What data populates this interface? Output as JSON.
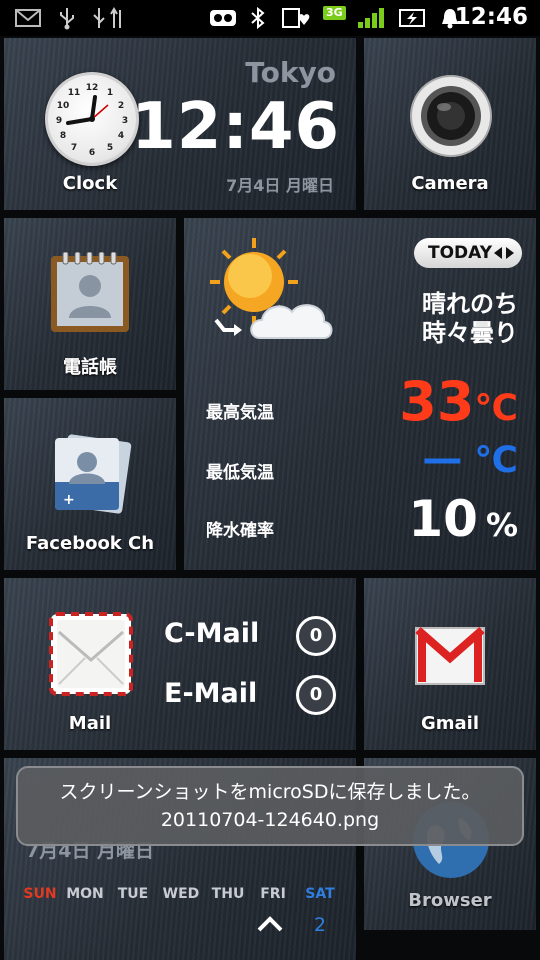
{
  "status_bar": {
    "network": "3G",
    "time": "12:46"
  },
  "clock_tile": {
    "label": "Clock",
    "city": "Tokyo",
    "time": "12:46",
    "date": "7月4日 月曜日"
  },
  "camera_tile": {
    "label": "Camera"
  },
  "phonebook_tile": {
    "label": "電話帳"
  },
  "facebook_tile": {
    "label": "Facebook Ch"
  },
  "weather_tile": {
    "today_label": "TODAY",
    "condition_line1": "晴れのち",
    "condition_line2": "時々曇り",
    "max_label": "最高気温",
    "max_value": "33",
    "max_unit": "℃",
    "min_label": "最低気温",
    "min_value": "—",
    "min_unit": "℃",
    "rain_label": "降水確率",
    "rain_value": "10",
    "rain_unit": "%"
  },
  "mail_tile": {
    "label": "Mail",
    "cmail_label": "C-Mail",
    "cmail_count": "0",
    "email_label": "E-Mail",
    "email_count": "0"
  },
  "gmail_tile": {
    "label": "Gmail"
  },
  "browser_tile": {
    "label": "Browser"
  },
  "calendar_tile": {
    "date": "7月4日 月曜日",
    "weekdays": [
      "SUN",
      "MON",
      "TUE",
      "WED",
      "THU",
      "FRI",
      "SAT"
    ],
    "visible_day": "2"
  },
  "toast": {
    "line1": "スクリーンショットをmicroSDに保存しました。",
    "line2": "20110704-124640.png"
  },
  "colors": {
    "max_temp": "#ff3b1a",
    "min_temp": "#1e6fe8",
    "sunday": "#e03a20",
    "saturday": "#2f7fe0",
    "signal": "#7ccc1c"
  }
}
